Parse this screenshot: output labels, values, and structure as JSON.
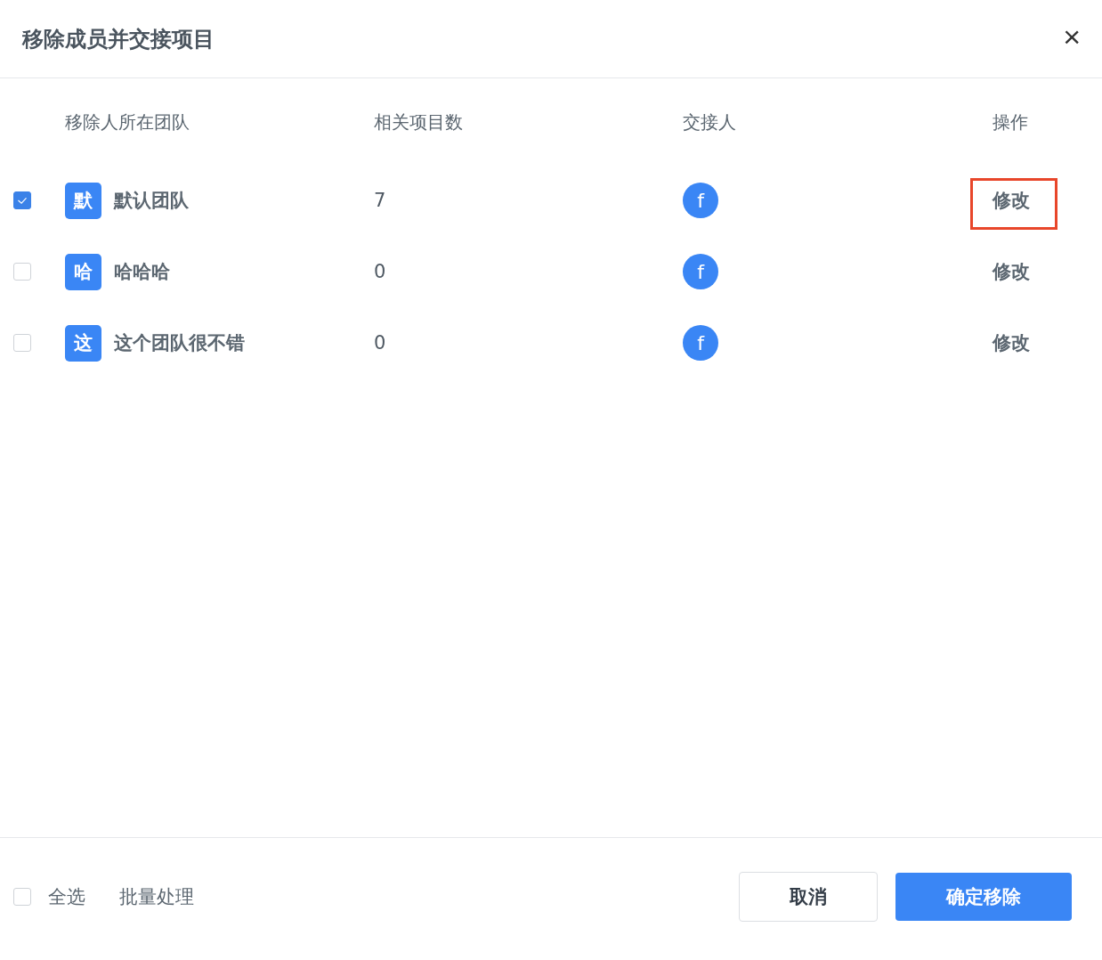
{
  "dialog": {
    "title": "移除成员并交接项目",
    "close": "×"
  },
  "table": {
    "columns": [
      "移除人所在团队",
      "相关项目数",
      "交接人",
      "操作"
    ],
    "rows": [
      {
        "checked": true,
        "avatar": "默",
        "team": "默认团队",
        "count": "7",
        "handover": "f",
        "action": "修改",
        "highlighted": true
      },
      {
        "checked": false,
        "avatar": "哈",
        "team": "哈哈哈",
        "count": "0",
        "handover": "f",
        "action": "修改",
        "highlighted": false
      },
      {
        "checked": false,
        "avatar": "这",
        "team": "这个团队很不错",
        "count": "0",
        "handover": "f",
        "action": "修改",
        "highlighted": false
      }
    ]
  },
  "footer": {
    "select_all": {
      "label": "全选",
      "checked": false
    },
    "batch": "批量处理",
    "cancel": "取消",
    "confirm": "确定移除"
  }
}
